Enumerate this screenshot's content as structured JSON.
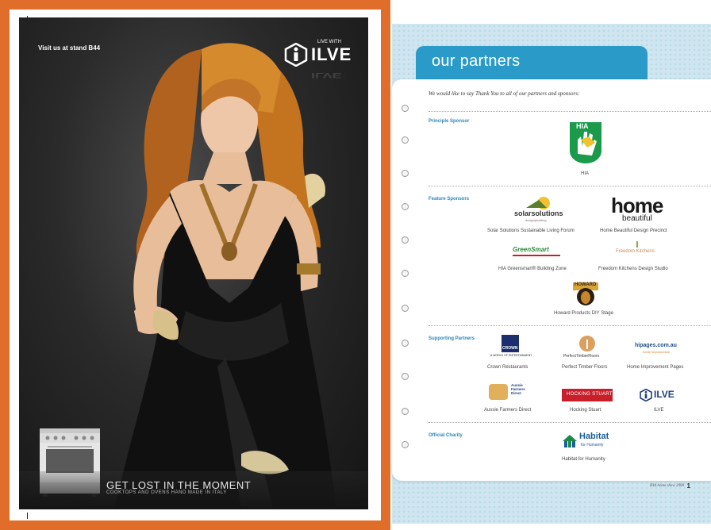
{
  "advert": {
    "stand_text": "Visit us at stand B44",
    "brand_tagline_top": "LIVE WITH",
    "brand": "ILVE",
    "tagline": "GET LOST IN THE MOMENT",
    "subtagline": "COOKTOPS AND OVENS HAND MADE IN ITALY"
  },
  "partners_page": {
    "title": "our partners",
    "intro": "We would like to say Thank You to all of our partners and sponsors:",
    "sections": {
      "principle": {
        "label": "Principle Sponsor",
        "items": [
          {
            "logo_text": "HIA",
            "caption": "HIA"
          }
        ]
      },
      "feature": {
        "label": "Feature Sponsors",
        "items": [
          {
            "logo_text": "solarsolutions",
            "logo_sub": "design|building",
            "caption": "Solar Solutions Sustainable Living Forum"
          },
          {
            "logo_text": "home",
            "logo_sub": "beautiful",
            "caption": "Home Beautiful Design Precinct"
          },
          {
            "logo_text": "GreenSmart",
            "caption": "HIA Greensmart® Building Zone"
          },
          {
            "logo_text": "Freedom Kitchens",
            "caption": "Freedom Kitchens Design Studio"
          },
          {
            "logo_text": "HOWARD",
            "caption": "Howard Products DIY Stage"
          }
        ]
      },
      "supporting": {
        "label": "Supporting Partners",
        "items": [
          {
            "logo_text": "CROWN",
            "logo_sub": "A WORLD OF ENTERTAINMENT",
            "caption": "Crown Restaurants"
          },
          {
            "logo_text": "PerfectTimberFloors",
            "caption": "Perfect Timber Floors"
          },
          {
            "logo_text": "hipages.com.au",
            "logo_sub": "home improvement",
            "caption": "Home Improvement Pages"
          },
          {
            "logo_text": "Aussie Farmers Direct",
            "caption": "Aussie Farmers Direct"
          },
          {
            "logo_text": "HOCKING STUART",
            "caption": "Hocking Stuart"
          },
          {
            "logo_text": "ILVE",
            "caption": "ILVE"
          }
        ]
      },
      "charity": {
        "label": "Official Charity",
        "items": [
          {
            "logo_text": "Habitat",
            "logo_sub": "for Humanity",
            "caption": "Habitat for Humanity"
          }
        ]
      }
    },
    "footer": "HIA home show 2009",
    "page_number": "1"
  },
  "colors": {
    "frame": "#e06e2a",
    "title_bar": "#2a9ac8",
    "section_label": "#2a85b8",
    "hia_green": "#1a9a4a",
    "hocking_red": "#c8202a"
  }
}
